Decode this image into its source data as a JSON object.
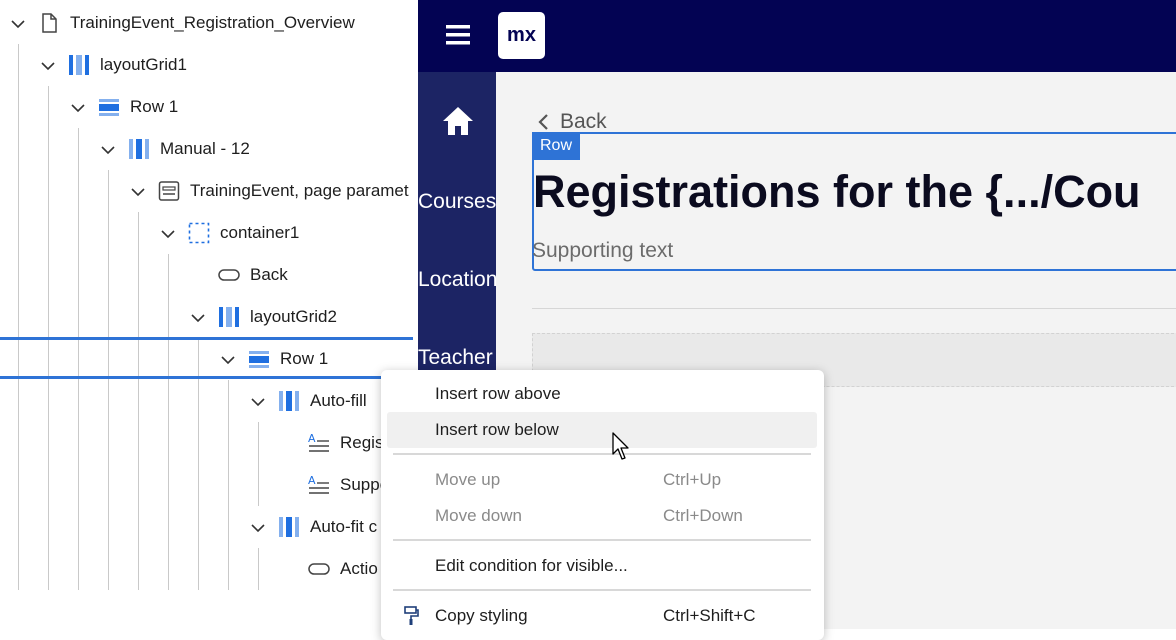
{
  "tree": {
    "items": [
      {
        "label": "TrainingEvent_Registration_Overview",
        "icon": "page-icon"
      },
      {
        "label": "layoutGrid1",
        "icon": "layout-grid-icon"
      },
      {
        "label": "Row 1",
        "icon": "row-icon"
      },
      {
        "label": "Manual - 12",
        "icon": "column-icon"
      },
      {
        "label": "TrainingEvent, page paramet",
        "icon": "dataview-icon"
      },
      {
        "label": "container1",
        "icon": "container-icon"
      },
      {
        "label": "Back",
        "icon": "button-icon"
      },
      {
        "label": "layoutGrid2",
        "icon": "layout-grid-icon"
      },
      {
        "label": "Row 1",
        "icon": "row-icon"
      },
      {
        "label": "Auto-fill",
        "icon": "column-icon"
      },
      {
        "label": "Regis",
        "icon": "text-icon"
      },
      {
        "label": "Suppo",
        "icon": "text-icon"
      },
      {
        "label": "Auto-fit c",
        "icon": "column-icon"
      },
      {
        "label": "Actio",
        "icon": "button-icon"
      }
    ]
  },
  "app": {
    "logo": "mx",
    "nav": [
      "Courses",
      "Location",
      "Teacher"
    ],
    "back_label": "Back",
    "row_tag": "Row",
    "title": "Registrations for the {.../Cou",
    "supporting_text": "Supporting text"
  },
  "context_menu": {
    "items": [
      {
        "label": "Insert row above",
        "shortcut": "",
        "enabled": true
      },
      {
        "label": "Insert row below",
        "shortcut": "",
        "enabled": true,
        "hovered": true
      },
      {
        "label": "Move up",
        "shortcut": "Ctrl+Up",
        "enabled": false
      },
      {
        "label": "Move down",
        "shortcut": "Ctrl+Down",
        "enabled": false
      },
      {
        "label": "Edit condition for visible...",
        "shortcut": "",
        "enabled": true
      },
      {
        "label": "Copy styling",
        "shortcut": "Ctrl+Shift+C",
        "enabled": true,
        "icon": "paint-brush-icon"
      }
    ]
  },
  "colors": {
    "accent": "#2e73d6",
    "topbar": "#030353",
    "sidenav": "#1c2464",
    "grid_icon": "#1f6fe0"
  }
}
